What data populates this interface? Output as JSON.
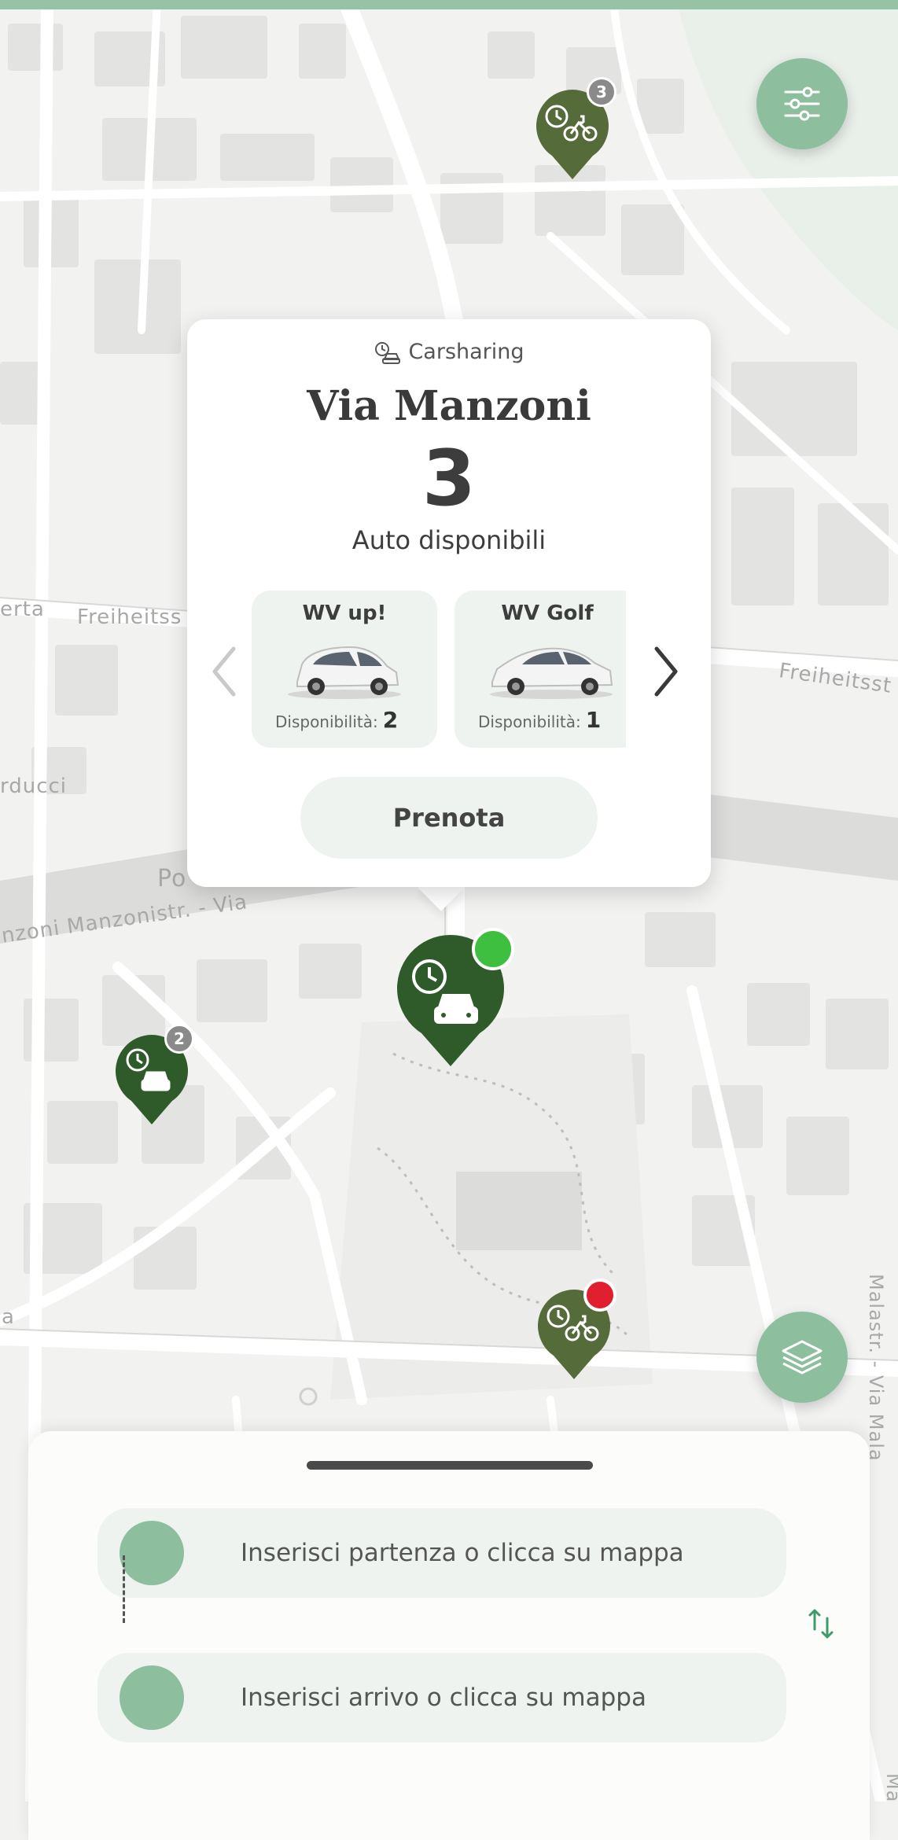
{
  "popup": {
    "service_label": "Carsharing",
    "station_name": "Via Manzoni",
    "available_count": "3",
    "available_label": "Auto disponibili",
    "vehicles": [
      {
        "name": "WV up!",
        "availability_label": "Disponibilità:",
        "availability_value": "2"
      },
      {
        "name": "WV Golf",
        "availability_label": "Disponibilità:",
        "availability_value": "1"
      }
    ],
    "book_label": "Prenota"
  },
  "map": {
    "street_labels": [
      "erta",
      "Freiheitss",
      "Freiheitsst",
      "rducci",
      "Po",
      "nzoni Manzonistr. - Via",
      "Malastr. - Via Mala",
      "a",
      "Ma"
    ],
    "markers": [
      {
        "type": "bike-sharing",
        "badge": "3"
      },
      {
        "type": "carsharing",
        "badge": "2"
      },
      {
        "type": "carsharing-selected",
        "status": "available"
      },
      {
        "type": "bike-sharing",
        "status": "unavailable"
      }
    ]
  },
  "route": {
    "start_placeholder": "Inserisci partenza o clicca su mappa",
    "end_placeholder": "Inserisci arrivo o clicca su mappa"
  },
  "colors": {
    "accent": "#8dbf9f",
    "marker_dark": "#2f5b2b",
    "marker_olive": "#566b3a",
    "status_available": "#3fbf3f",
    "status_unavailable": "#e0202e"
  }
}
